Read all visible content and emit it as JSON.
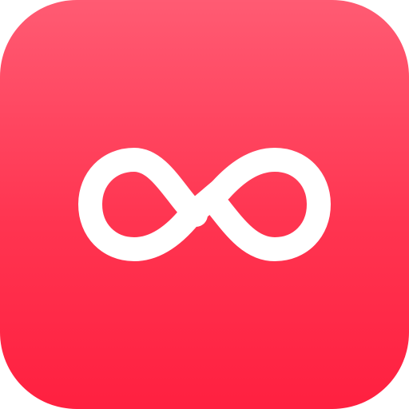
{
  "icon": {
    "name": "infinity-icon",
    "gradient_top": "#ff5b73",
    "gradient_bottom": "#ff2040",
    "glyph_color": "#ffffff"
  }
}
